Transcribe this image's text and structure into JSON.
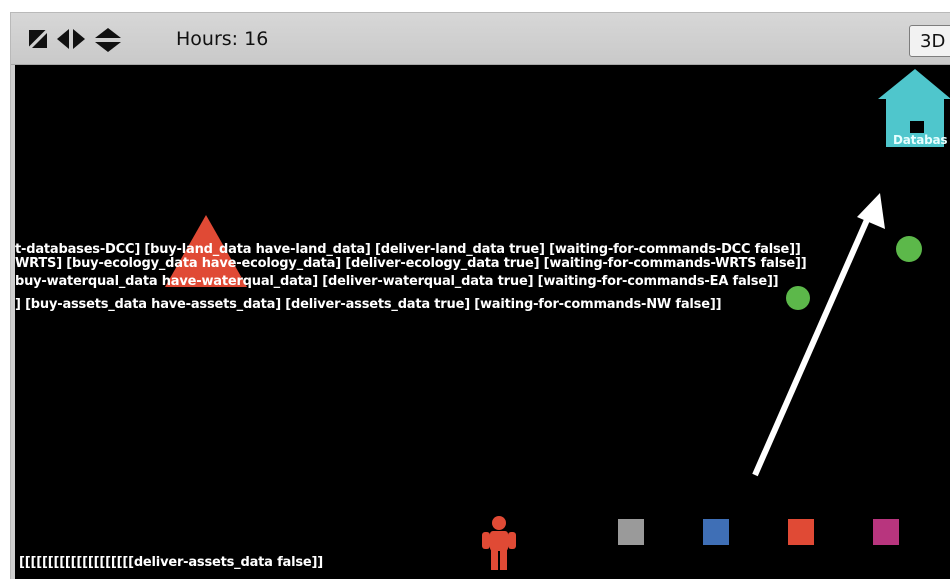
{
  "toolbar": {
    "hours_label": "Hours: 16",
    "view_3d_label": "3D",
    "icons": [
      "diagonal-arrow-icon",
      "horizontal-arrows-icon",
      "vertical-arrows-icon"
    ]
  },
  "world": {
    "background": "#000000",
    "database_label": "Databas",
    "label_lines": [
      "t-databases-DCC] [buy-land_data have-land_data] [deliver-land_data true] [waiting-for-commands-DCC false]]",
      "WRTS] [buy-ecology_data have-ecology_data] [deliver-ecology_data true] [waiting-for-commands-WRTS false]]",
      "buy-waterqual_data have-waterqual_data] [deliver-waterqual_data true] [waiting-for-commands-EA false]]",
      "] [buy-assets_data have-assets_data] [deliver-assets_data true] [waiting-for-commands-NW false]]",
      "[[[[[[[[[[[[[[[[[[[[deliver-assets_data false]]"
    ],
    "colors": {
      "house": "#4fc6cc",
      "triangle": "#e04a35",
      "person": "#e04a35",
      "green_agent": "#5cb84a",
      "arrow": "#ffffff",
      "patch_gray": "#9a9a9a",
      "patch_blue": "#3f6fb6",
      "patch_red": "#e04a35",
      "patch_magenta": "#b8357e"
    }
  }
}
